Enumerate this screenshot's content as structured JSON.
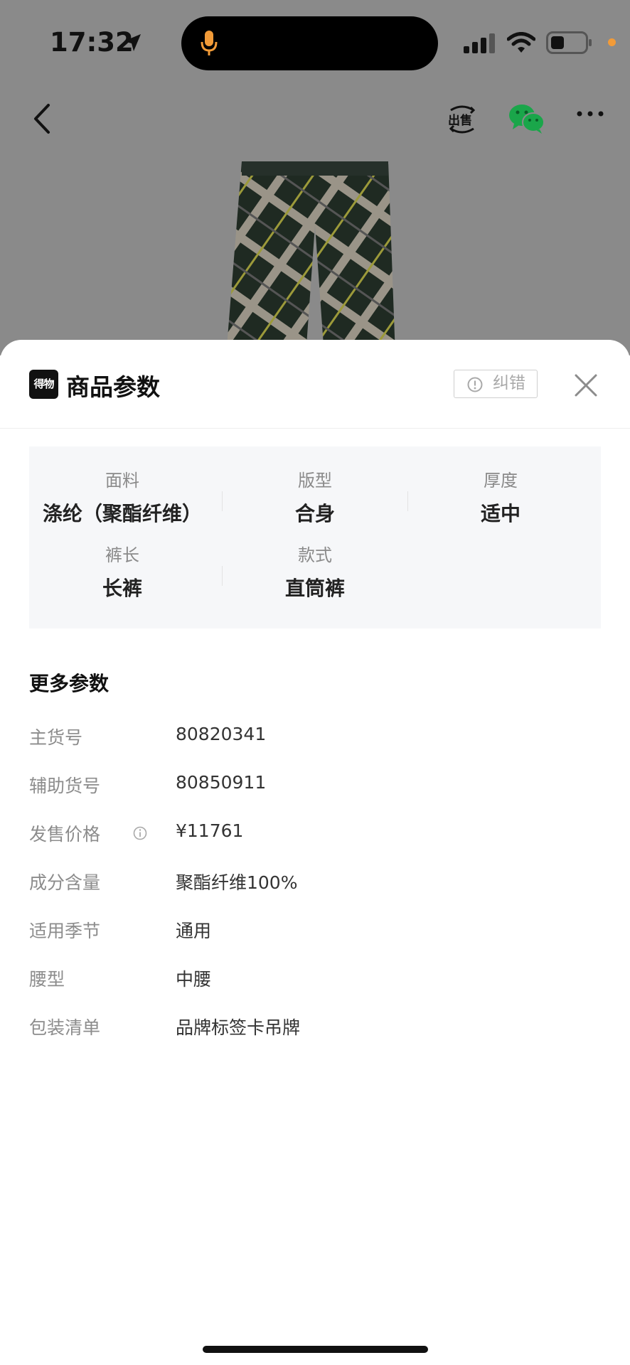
{
  "status_bar": {
    "time": "17:32"
  },
  "sheet": {
    "logo_text": "得物",
    "title": "商品参数",
    "report_label": "纠错",
    "params": [
      {
        "label": "面料",
        "value": "涤纶（聚酯纤维）"
      },
      {
        "label": "版型",
        "value": "合身"
      },
      {
        "label": "厚度",
        "value": "适中"
      },
      {
        "label": "裤长",
        "value": "长裤"
      },
      {
        "label": "款式",
        "value": "直筒裤"
      }
    ],
    "more_title": "更多参数",
    "specs": [
      {
        "key": "主货号",
        "value": "80820341"
      },
      {
        "key": "辅助货号",
        "value": "80850911"
      },
      {
        "key": "发售价格",
        "value": "¥11761"
      },
      {
        "key": "成分含量",
        "value": "聚酯纤维100%"
      },
      {
        "key": "适用季节",
        "value": "通用"
      },
      {
        "key": "腰型",
        "value": "中腰"
      },
      {
        "key": "包装清单",
        "value": "品牌标签卡吊牌"
      }
    ]
  },
  "colors": {
    "backdrop": "#8a8a8a",
    "panel_bg": "#f6f7f9",
    "status_dot": "#f29b38",
    "mic": "#f29b38"
  },
  "icons": [
    "location-arrow-icon",
    "microphone-icon",
    "signal-icon",
    "wifi-icon",
    "battery-icon",
    "back-chevron-icon",
    "sell-icon",
    "wechat-icon",
    "more-dots-icon",
    "info-circle-icon",
    "close-icon"
  ]
}
